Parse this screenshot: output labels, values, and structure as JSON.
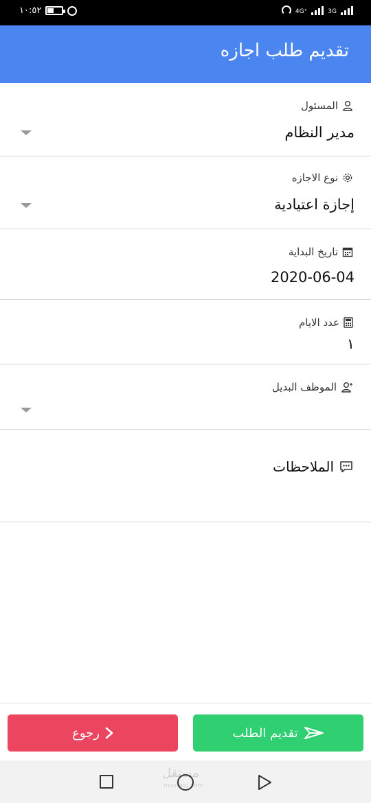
{
  "status_bar": {
    "time": "١٠:٥٢",
    "network_1": "4G⁺",
    "network_2": "3G"
  },
  "app_bar": {
    "title": "تقديم طلب اجازه"
  },
  "form": {
    "manager": {
      "label": "المسئول",
      "value": "مدير النظام",
      "icon": "user-icon"
    },
    "leave_type": {
      "label": "نوع الاجازه",
      "value": "إجازة اعتيادية",
      "icon": "gear-icon"
    },
    "start_date": {
      "label": "تاريخ البداية",
      "value": "2020-06-04",
      "icon": "calendar-icon"
    },
    "days_count": {
      "label": "عدد الايام",
      "value": "١",
      "icon": "calculator-icon"
    },
    "substitute": {
      "label": "الموظف البديل",
      "value": "",
      "icon": "user-icon"
    },
    "notes": {
      "label": "الملاحظات",
      "icon": "comment-icon"
    }
  },
  "actions": {
    "submit_label": "تقديم الطلب",
    "back_label": "رجوع"
  },
  "watermark": {
    "text": "مستقل",
    "sub": "mostaql.com"
  },
  "colors": {
    "app_bar": "#4b86f0",
    "submit": "#2fcf72",
    "back": "#ec4560"
  }
}
